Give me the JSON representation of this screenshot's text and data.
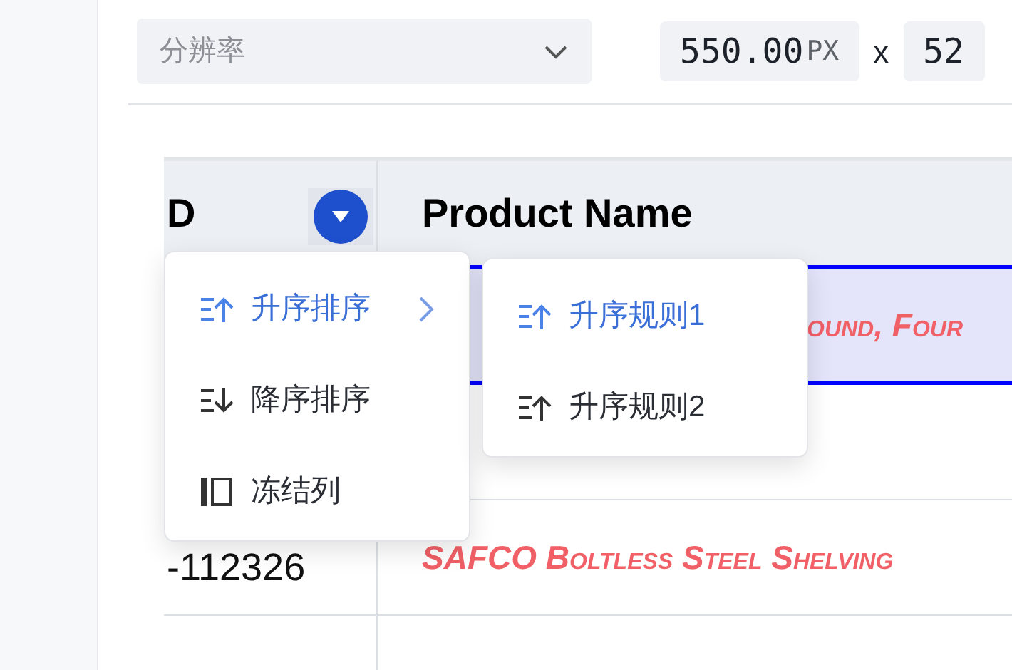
{
  "toolbar": {
    "resolution": {
      "placeholder": "分辨率"
    },
    "width": {
      "value": "550.00",
      "unit": "PX"
    },
    "separator": "x",
    "height": {
      "value": "52"
    }
  },
  "table": {
    "columns": [
      "D",
      "Product Name"
    ],
    "rows": [
      {
        "selected": true,
        "cells": [
          "",
          "ound, Four"
        ]
      },
      {
        "selected": false
      },
      {
        "selected": false,
        "cells": [
          "-112326",
          "SAFCO Boltless Steel Shelving"
        ]
      },
      {
        "selected": false
      }
    ]
  },
  "column_menu": {
    "items": [
      {
        "kind": "ascending",
        "label": "升序排序",
        "active": true,
        "submenu": true
      },
      {
        "kind": "descending",
        "label": "降序排序",
        "active": false,
        "submenu": false
      },
      {
        "kind": "freeze",
        "label": "冻结列",
        "active": false,
        "submenu": false
      }
    ]
  },
  "submenu": {
    "items": [
      {
        "kind": "ascending",
        "label": "升序规则1",
        "active": true
      },
      {
        "kind": "ascending",
        "label": "升序规则2",
        "active": false
      }
    ]
  }
}
